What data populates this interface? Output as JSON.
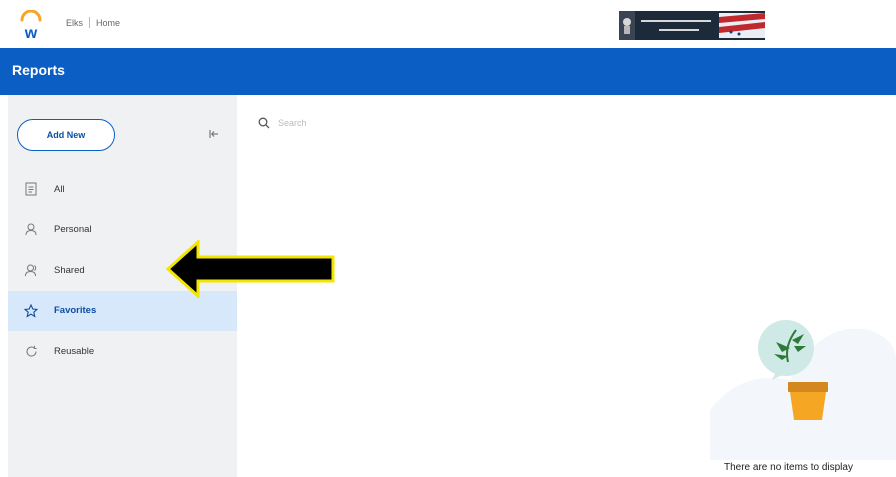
{
  "breadcrumb": {
    "org": "Elks",
    "home": "Home"
  },
  "header": {
    "title": "Reports"
  },
  "sidebar": {
    "add_new_label": "Add New",
    "items": [
      {
        "label": "All",
        "icon": "document-icon",
        "active": false
      },
      {
        "label": "Personal",
        "icon": "person-icon",
        "active": false
      },
      {
        "label": "Shared",
        "icon": "shared-person-icon",
        "active": false
      },
      {
        "label": "Favorites",
        "icon": "star-icon",
        "active": true
      },
      {
        "label": "Reusable",
        "icon": "refresh-icon",
        "active": false
      }
    ]
  },
  "search": {
    "placeholder": "Search"
  },
  "empty_state": {
    "message": "There are no items to display"
  },
  "colors": {
    "header_blue": "#0b5fc4",
    "sidebar_bg": "#f0f1f2",
    "active_bg": "#d7e8fb",
    "arrow_fill": "#000000",
    "arrow_outline": "#f2e600"
  }
}
